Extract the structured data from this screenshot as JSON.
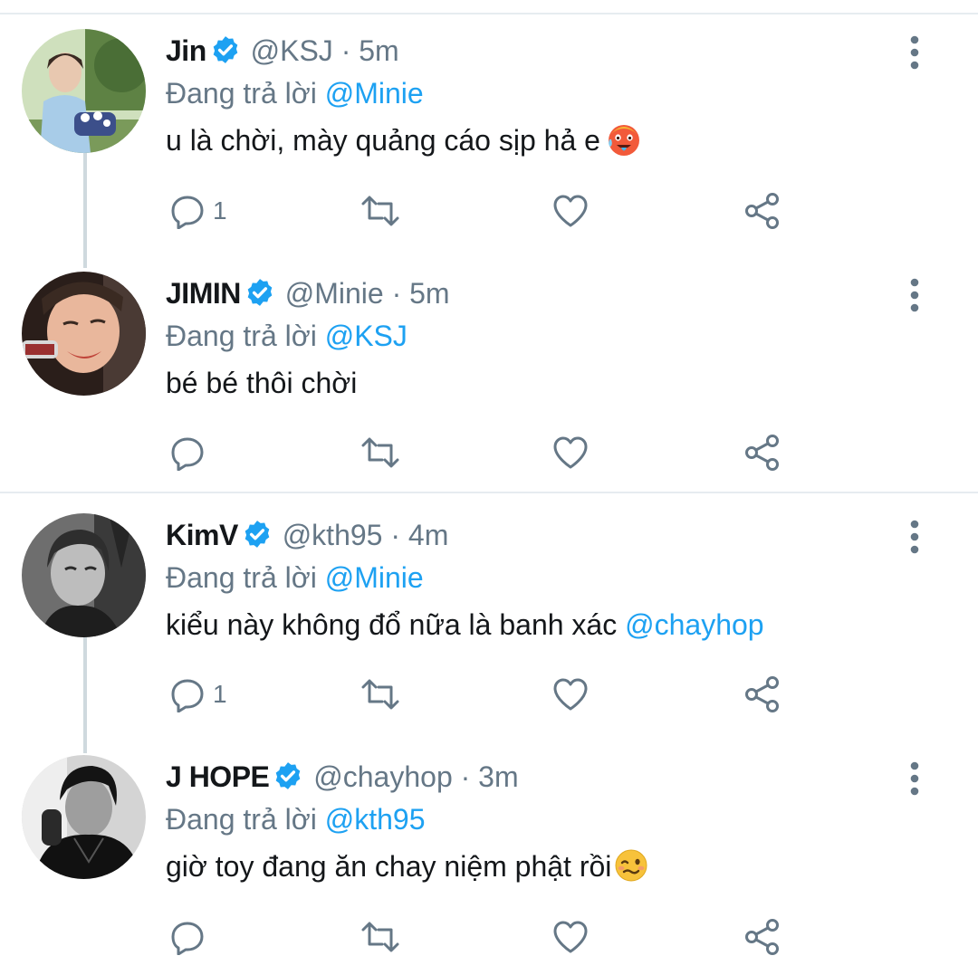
{
  "tweets": [
    {
      "name": "Jin",
      "handle": "@KSJ",
      "time": "5m",
      "reply_prefix": "Đang trả lời",
      "reply_to": "@Minie",
      "text": "u là chời, mày quảng cáo sịp hả e",
      "emoji": "hot-face-emoji",
      "reply_count": "1",
      "avatar_colors": [
        "#d8e6c8",
        "#6a8c4a",
        "#a9c8e6",
        "#3a5a2a"
      ]
    },
    {
      "name": "JIMIN",
      "handle": "@Minie",
      "time": "5m",
      "reply_prefix": "Đang trả lời",
      "reply_to": "@KSJ",
      "text": "bé bé thôi chời",
      "emoji": "",
      "reply_count": "",
      "avatar_colors": [
        "#c98c6a",
        "#3a2a22",
        "#e8b49a",
        "#1a1210"
      ]
    },
    {
      "name": "KimV",
      "handle": "@kth95",
      "time": "4m",
      "reply_prefix": "Đang trả lời",
      "reply_to": "@Minie",
      "text": "kiểu này không đổ nữa là banh xác",
      "text_mention": "@chayhop",
      "emoji": "",
      "reply_count": "1",
      "avatar_colors": [
        "#8a8a8a",
        "#2a2a2a",
        "#c8c8c8",
        "#4a4a4a"
      ]
    },
    {
      "name": "J HOPE",
      "handle": "@chayhop",
      "time": "3m",
      "reply_prefix": "Đang trả lời",
      "reply_to": "@kth95",
      "text": "giờ toy đang ăn chay niệm phật rồi",
      "emoji": "woozy-face-emoji",
      "reply_count": "",
      "avatar_colors": [
        "#dcdcdc",
        "#1a1a1a",
        "#9a9a9a",
        "#0a0a0a"
      ]
    }
  ],
  "colors": {
    "accent": "#1da1f2",
    "meta": "#657786",
    "text": "#14171a",
    "separator": "#e6ecf0"
  }
}
